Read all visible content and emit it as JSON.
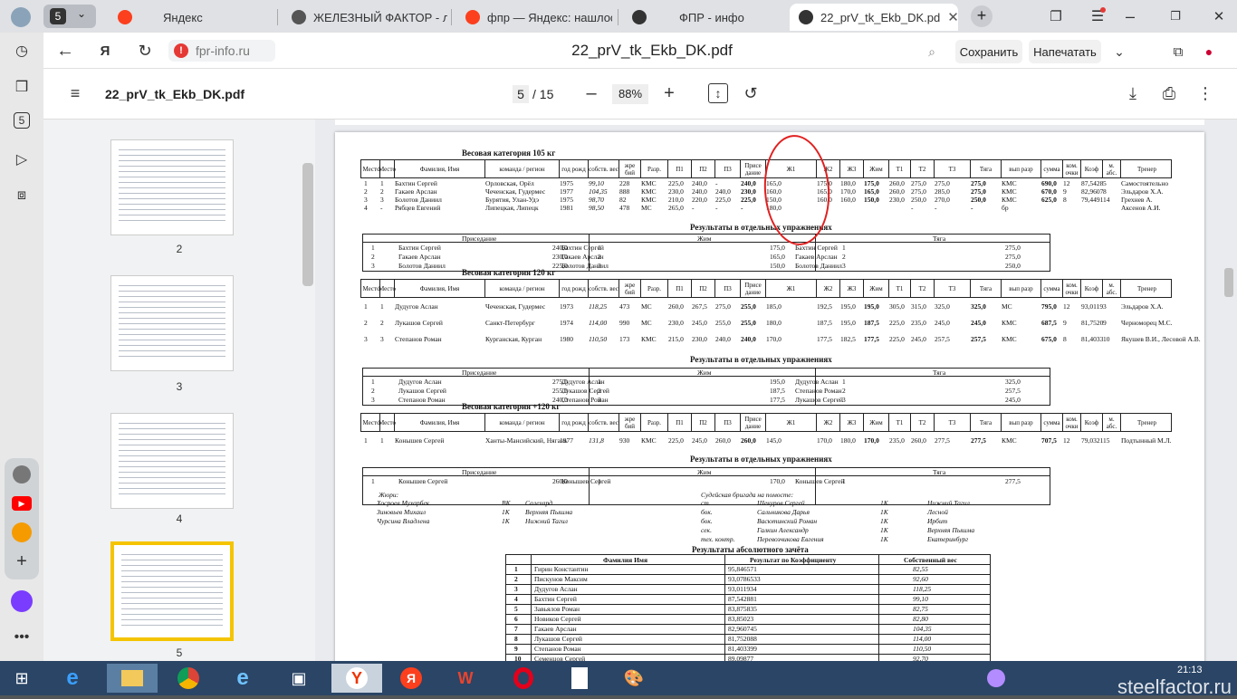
{
  "tabs": [
    {
      "label": "5",
      "icon": "workspace-icon"
    },
    {
      "label": "Яндекс",
      "icon": "yandex-icon"
    },
    {
      "label": "ЖЕЛЕЗНЫЙ ФАКТОР - л",
      "icon": "site-icon"
    },
    {
      "label": "фпр — Яндекс: нашлось",
      "icon": "yandex-icon"
    },
    {
      "label": "ФПР - инфо",
      "icon": "fpr-icon"
    },
    {
      "label": "22_prV_tk_Ekb_DK.pd",
      "icon": "fpr-icon"
    }
  ],
  "address": {
    "domain": "fpr-info.ru",
    "title": "22_prV_tk_Ekb_DK.pdf",
    "save": "Сохранить",
    "print": "Напечатать"
  },
  "pdf": {
    "filename": "22_prV_tk_Ekb_DK.pdf",
    "page": "5",
    "total": "/ 15",
    "zoom": "88%"
  },
  "thumbs": [
    "2",
    "3",
    "4",
    "5"
  ],
  "doc": {
    "cat105": "Весовая категория 105 кг",
    "cat120": "Весовая категория 120 кг",
    "cat120p": "Весовая категория +120 кг",
    "results": "Результаты в отдельных упражнениях",
    "abs": "Результаты абсолютного зачёта",
    "headers": [
      "Место",
      "Место",
      "Фамилия, Имя",
      "команда / регион",
      "год рожд",
      "собств. вес",
      "жре бий",
      "Разр.",
      "П1",
      "П2",
      "П3",
      "Присе дание",
      "Ж1",
      "Ж2",
      "Ж3",
      "Жим",
      "Т1",
      "Т2",
      "Т3",
      "Тяга",
      "вып разр",
      "сумма",
      "ком. очки",
      "Коэф",
      "м. абс.",
      "Тренер"
    ],
    "rows105": [
      [
        "1",
        "1",
        "Бахтин Сергей",
        "Орловская, Орёл",
        "1975",
        "99,10",
        "228",
        "КМС",
        "225,0",
        "240,0",
        "-",
        "240,0",
        "165,0",
        "175,0",
        "180,0",
        "175,0",
        "260,0",
        "275,0",
        "275,0",
        "275,0",
        "КМС",
        "690,0",
        "12",
        "87,5428",
        "5",
        "Самостоятельно"
      ],
      [
        "2",
        "2",
        "Гакаев Арслан",
        "Чеченская, Гудермес",
        "1977",
        "104,35",
        "888",
        "КМС",
        "230,0",
        "240,0",
        "240,0",
        "230,0",
        "160,0",
        "165,0",
        "170,0",
        "165,0",
        "260,0",
        "275,0",
        "285,0",
        "275,0",
        "КМС",
        "670,0",
        "9",
        "82,9607",
        "8",
        "Эльдаров Х.А."
      ],
      [
        "3",
        "3",
        "Болотов Даниил",
        "Бурятия, Улан-Удэ",
        "1975",
        "98,70",
        "82",
        "КМС",
        "210,0",
        "220,0",
        "225,0",
        "225,0",
        "150,0",
        "160,0",
        "160,0",
        "150,0",
        "230,0",
        "250,0",
        "270,0",
        "250,0",
        "КМС",
        "625,0",
        "8",
        "79,4491",
        "14",
        "Грехнев А."
      ],
      [
        "4",
        "-",
        "Рябцев Евгений",
        "Липецкая, Липецк",
        "1981",
        "98,50",
        "478",
        "МС",
        "265,0",
        "-",
        "-",
        "-",
        "180,0",
        "",
        "",
        "",
        "",
        "-",
        "-",
        "-",
        "бр",
        "",
        "",
        "",
        "",
        "Аксенов А.И."
      ]
    ],
    "ex105": {
      "squat": "Приседание",
      "bench": "Жим",
      "dead": "Тяга",
      "s": [
        [
          "1",
          "Бахтин Сергей",
          "240,0"
        ],
        [
          "2",
          "Гакаев Арслан",
          "230,0"
        ],
        [
          "3",
          "Болотов Даниил",
          "225,0"
        ]
      ],
      "b": [
        [
          "1",
          "Бахтин Сергей",
          "175,0"
        ],
        [
          "2",
          "Гакаев Арслан",
          "165,0"
        ],
        [
          "3",
          "Болотов Даниил",
          "150,0"
        ]
      ],
      "d": [
        [
          "1",
          "Бахтин Сергей",
          "275,0"
        ],
        [
          "2",
          "Гакаев Арслан",
          "275,0"
        ],
        [
          "3",
          "Болотов Даниил",
          "250,0"
        ]
      ]
    },
    "rows120": [
      [
        "1",
        "1",
        "Дудугов Аслан",
        "Чеченская, Гудермес",
        "1973",
        "118,25",
        "473",
        "МС",
        "260,0",
        "267,5",
        "275,0",
        "255,0",
        "185,0",
        "192,5",
        "195,0",
        "195,0",
        "305,0",
        "315,0",
        "325,0",
        "325,0",
        "МС",
        "795,0",
        "12",
        "93,0119",
        "3",
        "Эльдаров Х.А."
      ],
      [
        "2",
        "2",
        "Лукашов Сергей",
        "Санкт-Петербург",
        "1974",
        "114,00",
        "990",
        "МС",
        "230,0",
        "245,0",
        "255,0",
        "255,0",
        "180,0",
        "187,5",
        "195,0",
        "187,5",
        "225,0",
        "235,0",
        "245,0",
        "245,0",
        "КМС",
        "687,5",
        "9",
        "81,7520",
        "9",
        "Черноморец М.С."
      ],
      [
        "3",
        "3",
        "Степанов Роман",
        "Курганская, Курган",
        "1980",
        "110,50",
        "173",
        "КМС",
        "215,0",
        "230,0",
        "240,0",
        "240,0",
        "170,0",
        "177,5",
        "182,5",
        "177,5",
        "225,0",
        "245,0",
        "257,5",
        "257,5",
        "КМС",
        "675,0",
        "8",
        "81,4033",
        "10",
        "Якушев В.И., Лесовой А.В."
      ]
    ],
    "ex120": {
      "s": [
        [
          "1",
          "Дудугов Аслан",
          "275,0"
        ],
        [
          "2",
          "Лукашов Сергей",
          "255,0"
        ],
        [
          "3",
          "Степанов Роман",
          "240,0"
        ]
      ],
      "b": [
        [
          "1",
          "Дудугов Аслан",
          "195,0"
        ],
        [
          "2",
          "Лукашов Сергей",
          "187,5"
        ],
        [
          "3",
          "Степанов Роман",
          "177,5"
        ]
      ],
      "d": [
        [
          "1",
          "Дудугов Аслан",
          "325,0"
        ],
        [
          "2",
          "Степанов Роман",
          "257,5"
        ],
        [
          "3",
          "Лукашов Сергей",
          "245,0"
        ]
      ]
    },
    "rows120p": [
      [
        "1",
        "1",
        "Конышев Сергей",
        "Ханты-Мансийский, Нягань",
        "1977",
        "131,8",
        "930",
        "КМС",
        "225,0",
        "245,0",
        "260,0",
        "260,0",
        "145,0",
        "170,0",
        "180,0",
        "170,0",
        "235,0",
        "260,0",
        "277,5",
        "277,5",
        "КМС",
        "707,5",
        "12",
        "79,0321",
        "15",
        "Подтынный М.Л."
      ]
    ],
    "ex120p": {
      "s": [
        "1",
        "Конышев Сергей",
        "260,0"
      ],
      "b": [
        "1",
        "Конышев Сергей",
        "170,0"
      ],
      "d": [
        "1",
        "Конышев Сергей",
        "277,5"
      ]
    },
    "jury_title": "Жюри:",
    "jury": [
      [
        "Хосроев Мухарбек",
        "ВК",
        "Салехард"
      ],
      [
        "Зиновьев Михаил",
        "1К",
        "Верхняя Пышма"
      ],
      [
        "Чурсина Владлена",
        "1К",
        "Нижний Тагил"
      ]
    ],
    "brigade_title": "Судейская бригада на помосте:",
    "brigade": [
      [
        "ст.",
        "Шекуров Сергей",
        "1К",
        "Нижний Тагил"
      ],
      [
        "бок.",
        "Сальникова Дарья",
        "1К",
        "Лесной"
      ],
      [
        "бок.",
        "Васютинский Роман",
        "1К",
        "Ирбит"
      ],
      [
        "сек.",
        "Галкин Александр",
        "1К",
        "Верхняя Пышма"
      ],
      [
        "тех. контр.",
        "Перевозчикова Евгения",
        "1К",
        "Екатеринбург"
      ]
    ],
    "abs_headers": [
      "Фамилия Имя",
      "Результат по Коэффициенту",
      "Собственный вес"
    ],
    "abs_rows": [
      [
        "1",
        "Гирин Константин",
        "95,846571",
        "82,55"
      ],
      [
        "2",
        "Пискунов Максим",
        "93,0786533",
        "92,60"
      ],
      [
        "3",
        "Дудугов Аслан",
        "93,011934",
        "118,25"
      ],
      [
        "4",
        "Бахтин Сергей",
        "87,542881",
        "99,10"
      ],
      [
        "5",
        "Завьялов Роман",
        "83,875835",
        "82,75"
      ],
      [
        "6",
        "Новиков Сергей",
        "83,85023",
        "82,80"
      ],
      [
        "7",
        "Гакаев Арслан",
        "82,960745",
        "104,35"
      ],
      [
        "8",
        "Лукашов Сергей",
        "81,752088",
        "114,00"
      ],
      [
        "9",
        "Степанов Роман",
        "81,403399",
        "110,50"
      ],
      [
        "10",
        "Семенцов Сергей",
        "89,09877",
        "92,70"
      ]
    ]
  },
  "taskbar": {
    "time": "21:13",
    "watermark": "steelfactor.ru"
  },
  "colors": {
    "annotation": "#e02020",
    "thumb_selected": "#f5c400",
    "taskbar": "#2a4566"
  }
}
